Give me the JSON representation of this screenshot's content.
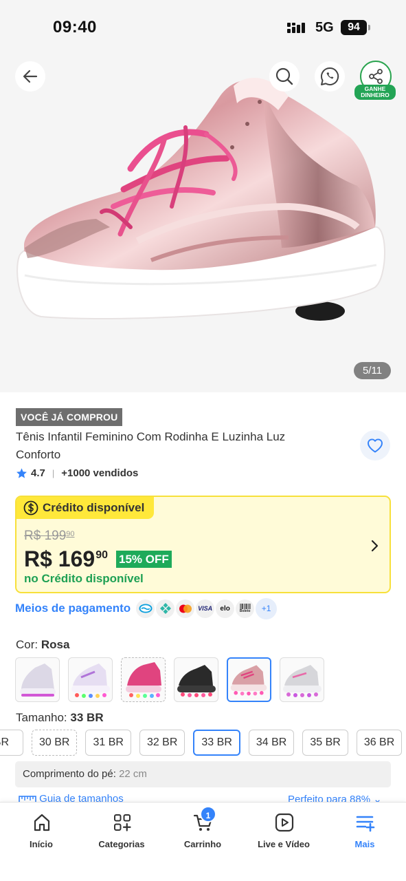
{
  "status_bar": {
    "time": "09:40",
    "network": "5G",
    "battery": "94"
  },
  "gallery": {
    "counter": "5/11",
    "share_badge": [
      "GANHE",
      "DINHEIRO"
    ]
  },
  "product": {
    "tag": "VOCÊ JÁ COMPROU",
    "title": "Tênis Infantil Feminino Com Rodinha E Luzinha Luz Conforto",
    "rating": "4.7",
    "sold": "+1000 vendidos"
  },
  "credit": {
    "header": "Crédito disponível",
    "old_price_int": "R$ 199",
    "old_price_cents": "90",
    "price_int": "R$ 169",
    "price_cents": "90",
    "discount": "15% OFF",
    "note": "no Crédito disponível"
  },
  "payment": {
    "label": "Meios de pagamento",
    "icons": [
      "mercado-pago",
      "pix",
      "mastercard",
      "visa",
      "elo",
      "boleto"
    ],
    "visa": "VISA",
    "elo": "elo",
    "boleto": "Boleto",
    "more": "+1"
  },
  "color": {
    "label": "Cor:",
    "value": "Rosa"
  },
  "size": {
    "label": "Tamanho:",
    "value": "33 BR",
    "options": [
      "BR",
      "30 BR",
      "31 BR",
      "32 BR",
      "33 BR",
      "34 BR",
      "35 BR",
      "36 BR"
    ]
  },
  "foot": {
    "label": "Comprimento do pé:",
    "value": "22 cm"
  },
  "peek": {
    "left": "Guia de tamanhos",
    "right": "Perfeito para 88%"
  },
  "tabbar": {
    "items": [
      "Início",
      "Categorias",
      "Carrinho",
      "Live e Vídeo",
      "Mais"
    ],
    "cart_count": "1"
  },
  "colors": {
    "accent": "#3483fa",
    "credit_bg": "#fffbd8",
    "credit_header": "#ffe83a",
    "success": "#1eaa5a"
  }
}
